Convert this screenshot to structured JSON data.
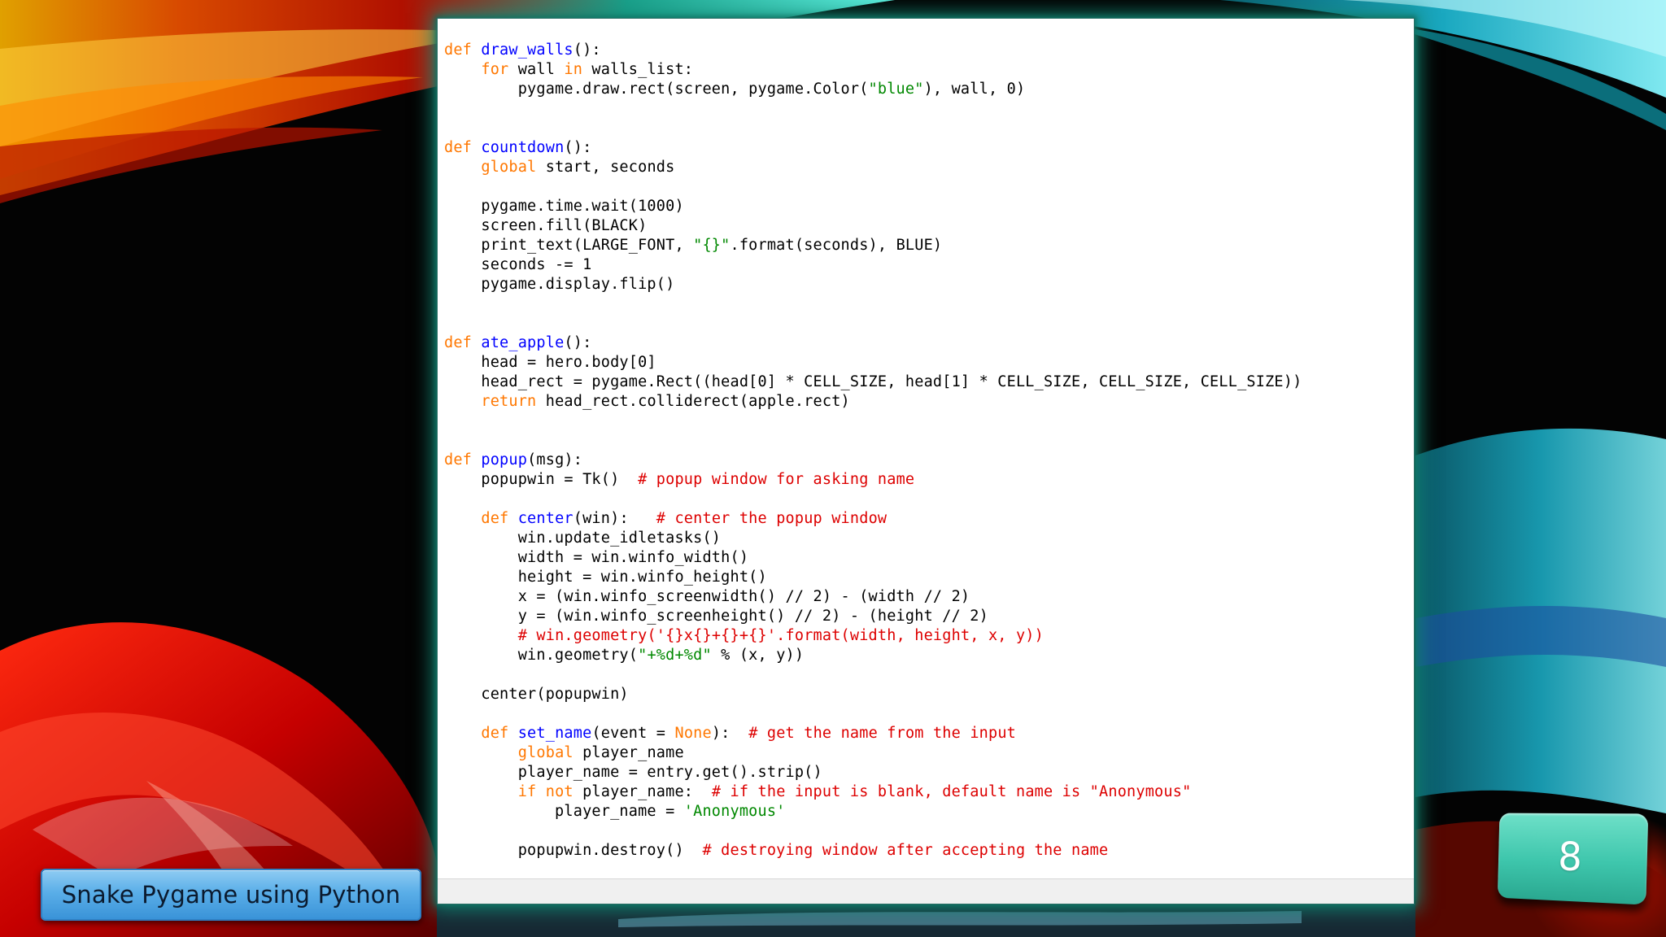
{
  "slide": {
    "title": "Snake Pygame using Python",
    "page_number": "8"
  },
  "colors": {
    "keyword": "#ff7700",
    "function_name": "#0000ff",
    "string": "#008800",
    "comment": "#dd0000",
    "title_badge": "#5aaee8",
    "page_badge": "#3ec6ac"
  },
  "code_lines": [
    [
      [
        "kw",
        "def "
      ],
      [
        "fn",
        "draw_walls"
      ],
      [
        "",
        "():"
      ]
    ],
    [
      [
        "",
        "    "
      ],
      [
        "kw",
        "for"
      ],
      [
        "",
        " wall "
      ],
      [
        "kw",
        "in"
      ],
      [
        "",
        " walls_list:"
      ]
    ],
    [
      [
        "",
        "        pygame.draw.rect(screen, pygame.Color("
      ],
      [
        "str",
        "\"blue\""
      ],
      [
        "",
        "), wall, 0)"
      ]
    ],
    [],
    [],
    [
      [
        "kw",
        "def "
      ],
      [
        "fn",
        "countdown"
      ],
      [
        "",
        "():"
      ]
    ],
    [
      [
        "",
        "    "
      ],
      [
        "kw",
        "global"
      ],
      [
        "",
        " start, seconds"
      ]
    ],
    [],
    [
      [
        "",
        "    pygame.time.wait(1000)"
      ]
    ],
    [
      [
        "",
        "    screen.fill(BLACK)"
      ]
    ],
    [
      [
        "",
        "    print_text(LARGE_FONT, "
      ],
      [
        "str",
        "\"{}\""
      ],
      [
        "",
        ".format(seconds), BLUE)"
      ]
    ],
    [
      [
        "",
        "    seconds -= 1"
      ]
    ],
    [
      [
        "",
        "    pygame.display.flip()"
      ]
    ],
    [],
    [],
    [
      [
        "kw",
        "def "
      ],
      [
        "fn",
        "ate_apple"
      ],
      [
        "",
        "():"
      ]
    ],
    [
      [
        "",
        "    head = hero.body[0]"
      ]
    ],
    [
      [
        "",
        "    head_rect = pygame.Rect((head[0] * CELL_SIZE, head[1] * CELL_SIZE, CELL_SIZE, CELL_SIZE))"
      ]
    ],
    [
      [
        "",
        "    "
      ],
      [
        "kw",
        "return"
      ],
      [
        "",
        " head_rect.colliderect(apple.rect)"
      ]
    ],
    [],
    [],
    [
      [
        "kw",
        "def "
      ],
      [
        "fn",
        "popup"
      ],
      [
        "",
        "(msg):"
      ]
    ],
    [
      [
        "",
        "    popupwin = Tk()  "
      ],
      [
        "cm",
        "# popup window for asking name"
      ]
    ],
    [],
    [
      [
        "",
        "    "
      ],
      [
        "kw",
        "def "
      ],
      [
        "fn",
        "center"
      ],
      [
        "",
        "(win):   "
      ],
      [
        "cm",
        "# center the popup window"
      ]
    ],
    [
      [
        "",
        "        win.update_idletasks()"
      ]
    ],
    [
      [
        "",
        "        width = win.winfo_width()"
      ]
    ],
    [
      [
        "",
        "        height = win.winfo_height()"
      ]
    ],
    [
      [
        "",
        "        x = (win.winfo_screenwidth() // 2) - (width // 2)"
      ]
    ],
    [
      [
        "",
        "        y = (win.winfo_screenheight() // 2) - (height // 2)"
      ]
    ],
    [
      [
        "",
        "        "
      ],
      [
        "cm",
        "# win.geometry('{}x{}+{}+{}'.format(width, height, x, y))"
      ]
    ],
    [
      [
        "",
        "        win.geometry("
      ],
      [
        "str",
        "\"+%d+%d\""
      ],
      [
        "",
        " % (x, y))"
      ]
    ],
    [],
    [
      [
        "",
        "    center(popupwin)"
      ]
    ],
    [],
    [
      [
        "",
        "    "
      ],
      [
        "kw",
        "def "
      ],
      [
        "fn",
        "set_name"
      ],
      [
        "",
        "(event = "
      ],
      [
        "kw",
        "None"
      ],
      [
        "",
        "):  "
      ],
      [
        "cm",
        "# get the name from the input"
      ]
    ],
    [
      [
        "",
        "        "
      ],
      [
        "kw",
        "global"
      ],
      [
        "",
        " player_name"
      ]
    ],
    [
      [
        "",
        "        player_name = entry.get().strip()"
      ]
    ],
    [
      [
        "",
        "        "
      ],
      [
        "kw",
        "if not"
      ],
      [
        "",
        " player_name:  "
      ],
      [
        "cm",
        "# if the input is blank, default name is \"Anonymous\""
      ]
    ],
    [
      [
        "",
        "            player_name = "
      ],
      [
        "str",
        "'Anonymous'"
      ]
    ],
    [],
    [
      [
        "",
        "        popupwin.destroy()  "
      ],
      [
        "cm",
        "# destroying window after accepting the name"
      ]
    ]
  ]
}
